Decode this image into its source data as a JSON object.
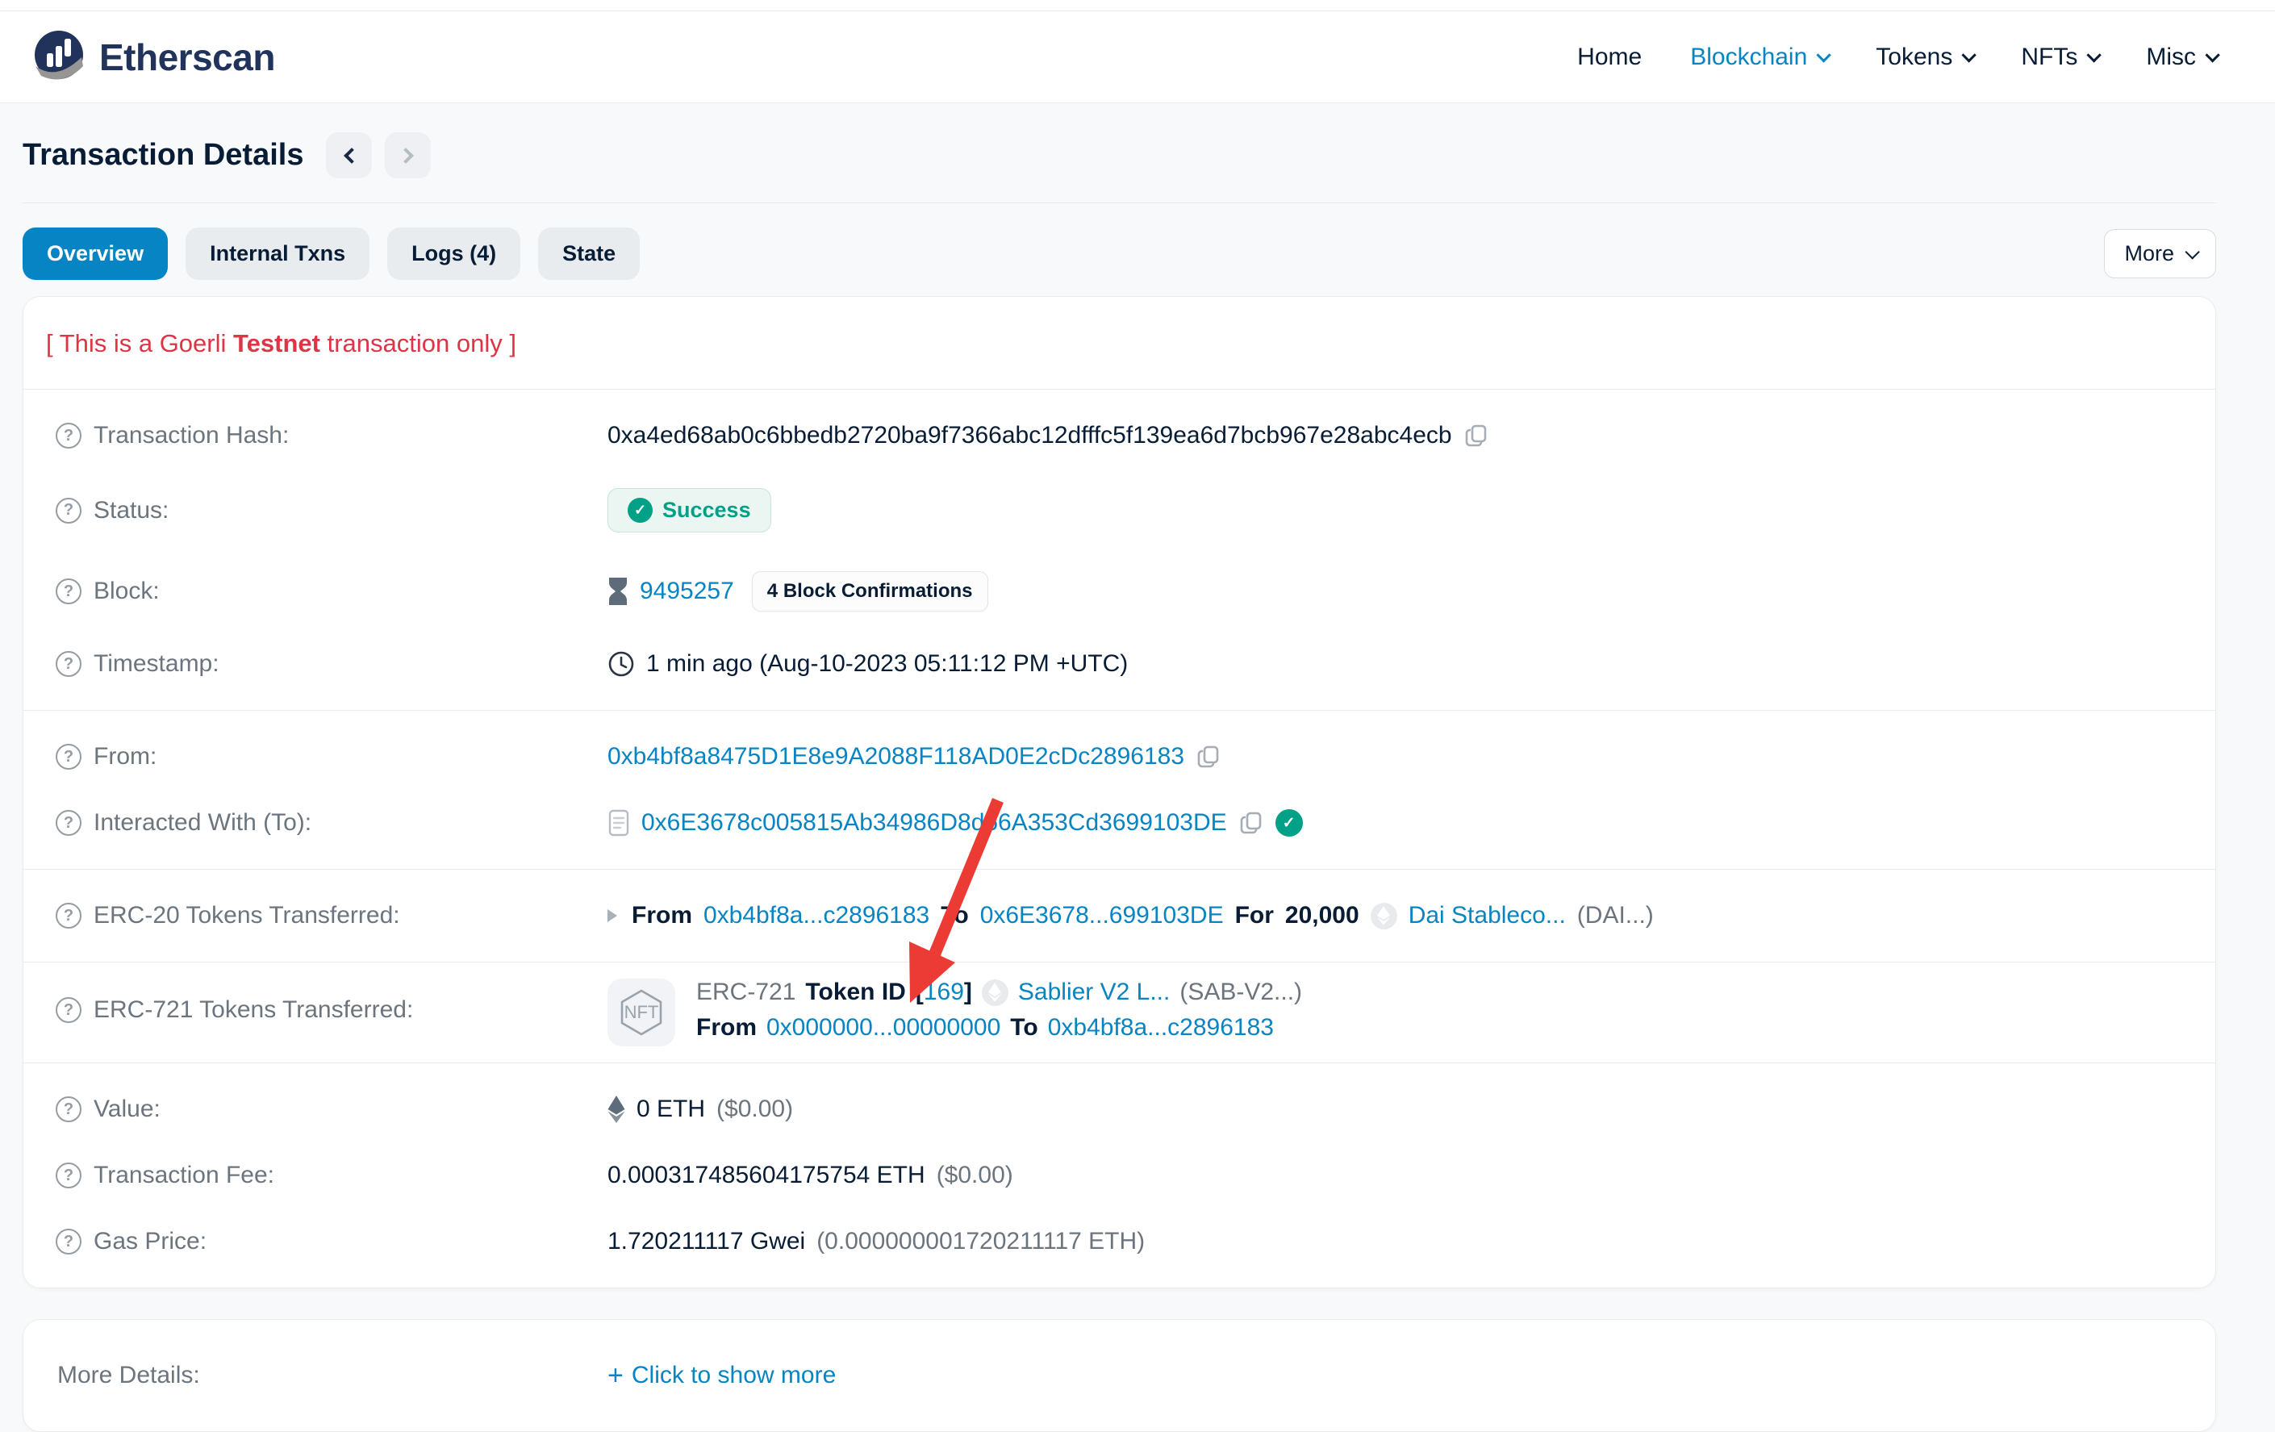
{
  "colors": {
    "link_blue": "#0784c3",
    "success_green": "#00a186",
    "alert_red": "#dc3545",
    "arrow_red": "#ec3b34",
    "navy": "#081d35"
  },
  "header": {
    "brand": "Etherscan",
    "nav": {
      "items": [
        {
          "label": "Home",
          "active": false,
          "dropdown": false
        },
        {
          "label": "Blockchain",
          "active": true,
          "dropdown": true
        },
        {
          "label": "Tokens",
          "active": false,
          "dropdown": true
        },
        {
          "label": "NFTs",
          "active": false,
          "dropdown": true
        },
        {
          "label": "Misc",
          "active": false,
          "dropdown": true
        }
      ]
    }
  },
  "page": {
    "title": "Transaction Details"
  },
  "tabs": [
    {
      "label": "Overview",
      "active": true
    },
    {
      "label": "Internal Txns",
      "active": false
    },
    {
      "label": "Logs (4)",
      "active": false
    },
    {
      "label": "State",
      "active": false
    }
  ],
  "more_button": {
    "label": "More"
  },
  "notice": {
    "prefix": "[ This is a Goerli ",
    "bold": "Testnet",
    "suffix": " transaction only ]"
  },
  "rows": {
    "hash": {
      "label": "Transaction Hash:",
      "value": "0xa4ed68ab0c6bbedb2720ba9f7366abc12dfffc5f139ea6d7bcb967e28abc4ecb"
    },
    "status": {
      "label": "Status:",
      "value": "Success"
    },
    "block": {
      "label": "Block:",
      "number": "9495257",
      "confirmations": "4 Block Confirmations"
    },
    "timestamp": {
      "label": "Timestamp:",
      "value": "1 min ago (Aug-10-2023 05:11:12 PM +UTC)"
    },
    "from": {
      "label": "From:",
      "address": "0xb4bf8a8475D1E8e9A2088F118AD0E2cDc2896183"
    },
    "interacted": {
      "label": "Interacted With (To):",
      "address": "0x6E3678c005815Ab34986D8d66A353Cd3699103DE"
    },
    "erc20": {
      "label": "ERC-20 Tokens Transferred:",
      "from_label": "From",
      "from": "0xb4bf8a...c2896183",
      "to_label": "To",
      "to": "0x6E3678...699103DE",
      "for_label": "For",
      "amount": "20,000",
      "token": "Dai Stableco...",
      "symbol": "(DAI...)"
    },
    "erc721": {
      "label": "ERC-721 Tokens Transferred:",
      "nft_badge": "NFT",
      "standard": "ERC-721",
      "token_id_label": "Token ID",
      "bracket_open": "[",
      "token_id": "169",
      "bracket_close": "]",
      "token": "Sablier V2 L...",
      "symbol": "(SAB-V2...)",
      "from_label": "From",
      "from": "0x000000...00000000",
      "to_label": "To",
      "to": "0xb4bf8a...c2896183"
    },
    "value": {
      "label": "Value:",
      "amount": "0 ETH",
      "usd": "($0.00)"
    },
    "fee": {
      "label": "Transaction Fee:",
      "amount": "0.000317485604175754 ETH",
      "usd": "($0.00)"
    },
    "gas_price": {
      "label": "Gas Price:",
      "amount": "1.720211117 Gwei",
      "alt": "(0.000000001720211117 ETH)"
    }
  },
  "more_details": {
    "label": "More Details:",
    "plus": "+",
    "action": "Click to show more"
  }
}
